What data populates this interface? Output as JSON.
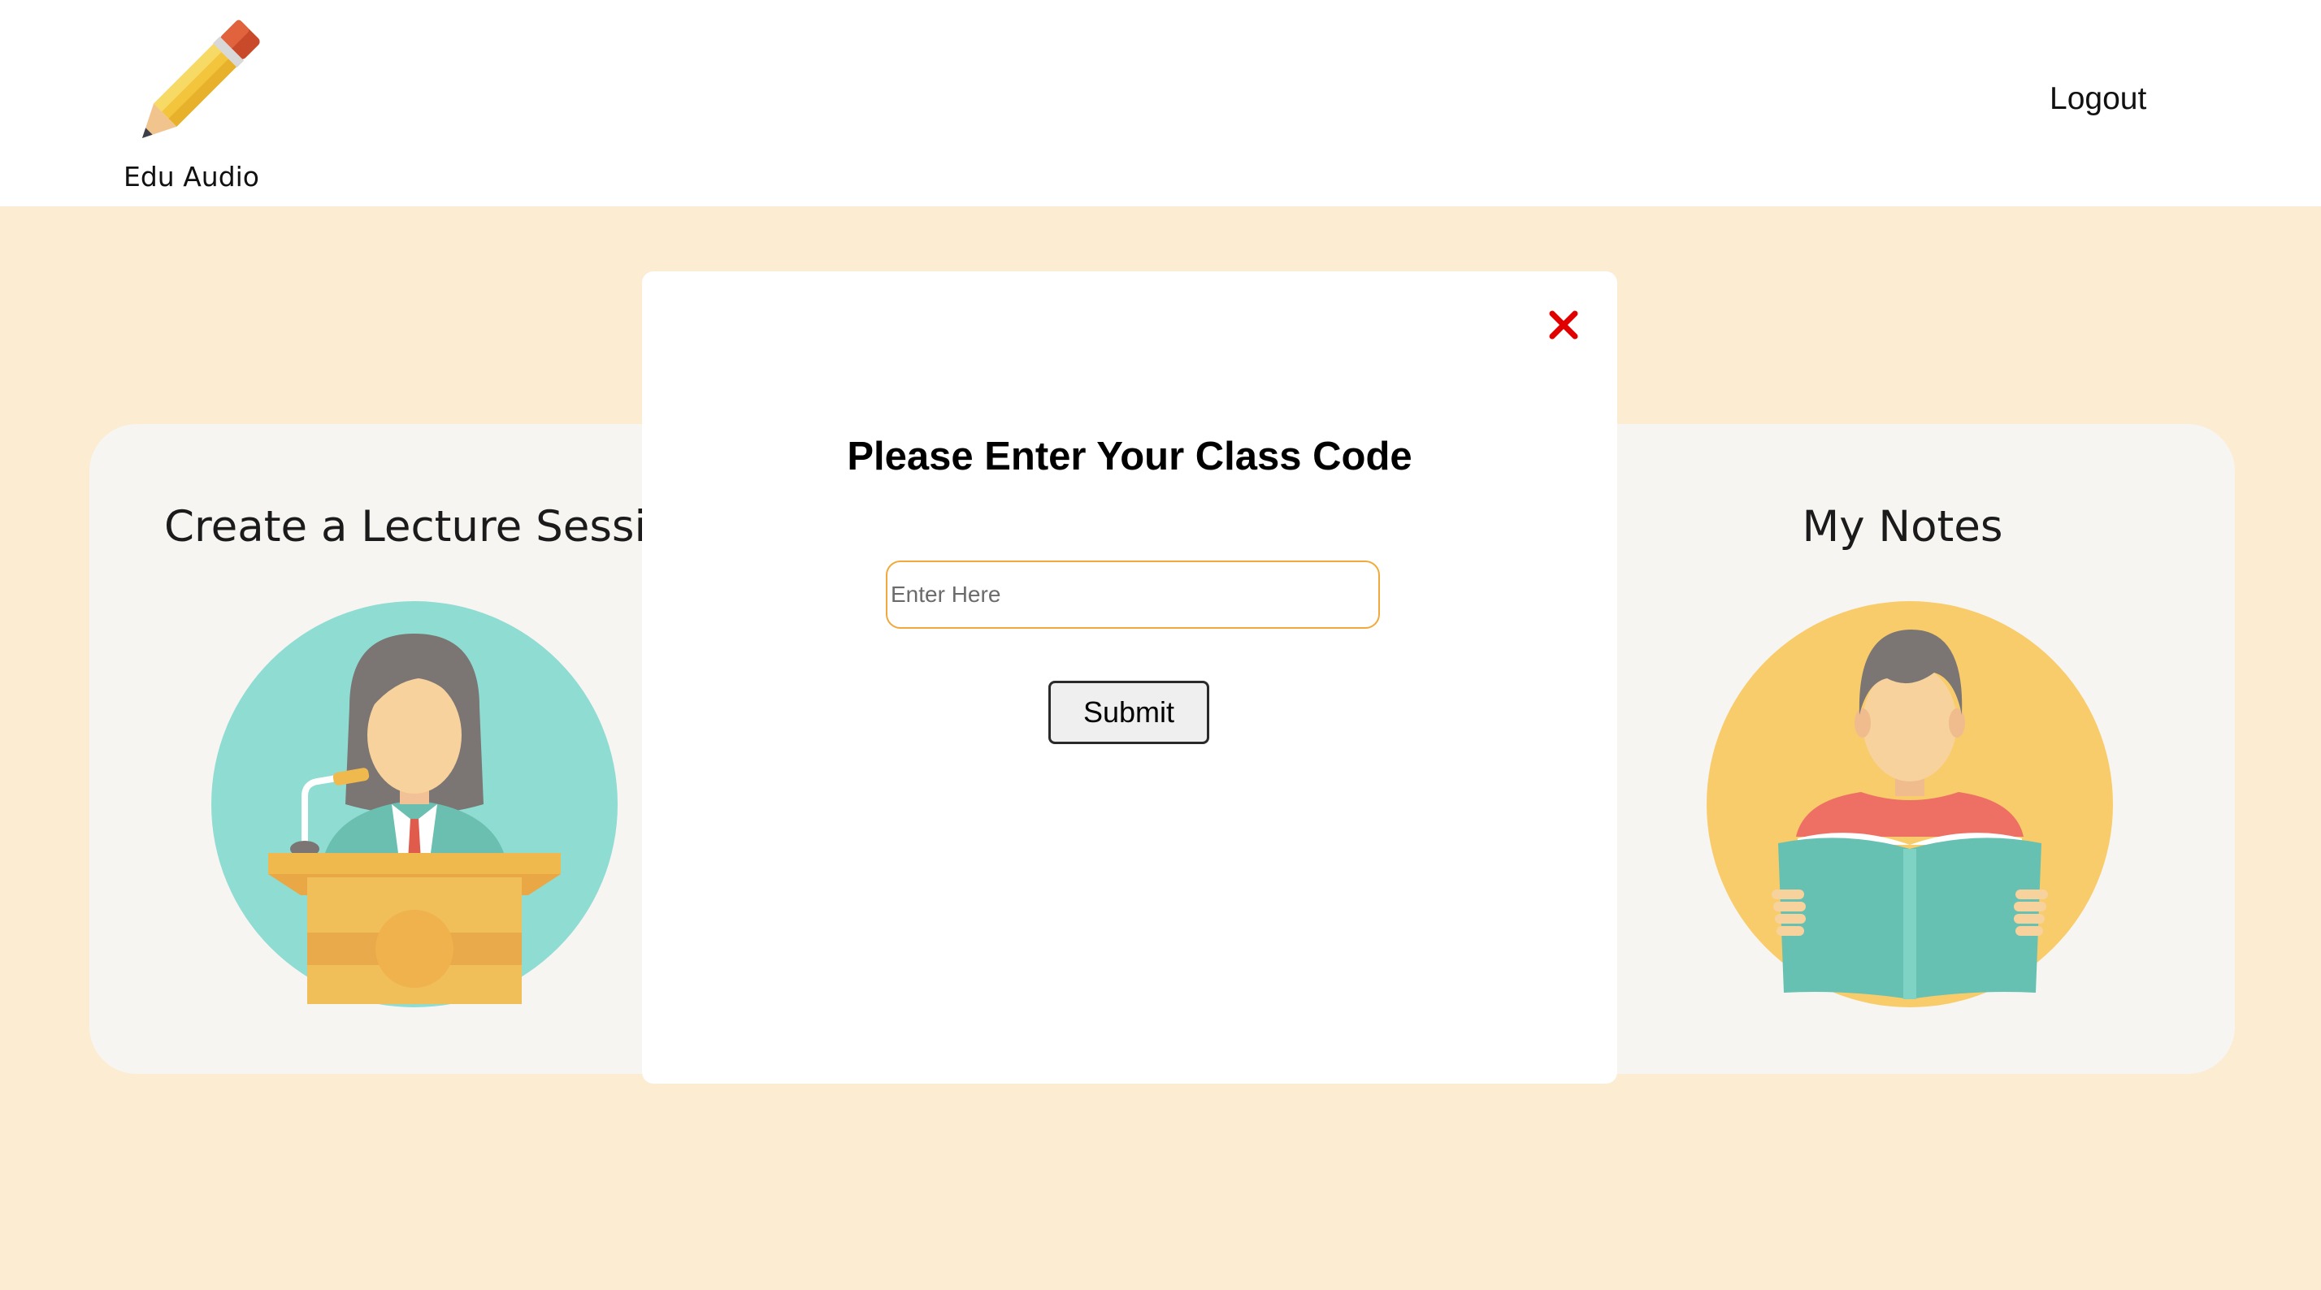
{
  "header": {
    "logo_text": "Edu Audio",
    "logout_label": "Logout"
  },
  "cards": {
    "create_lecture_title": "Create a Lecture Sessio",
    "my_notes_title": "My Notes"
  },
  "modal": {
    "title": "Please Enter Your Class Code",
    "input_placeholder": "Enter Here",
    "input_value": "",
    "submit_label": "Submit",
    "close_icon": "close-icon"
  },
  "colors": {
    "page_background": "#fbecd2",
    "card_background": "#f7f5f2",
    "input_border": "#f0a93a",
    "close_icon": "#e00000"
  }
}
